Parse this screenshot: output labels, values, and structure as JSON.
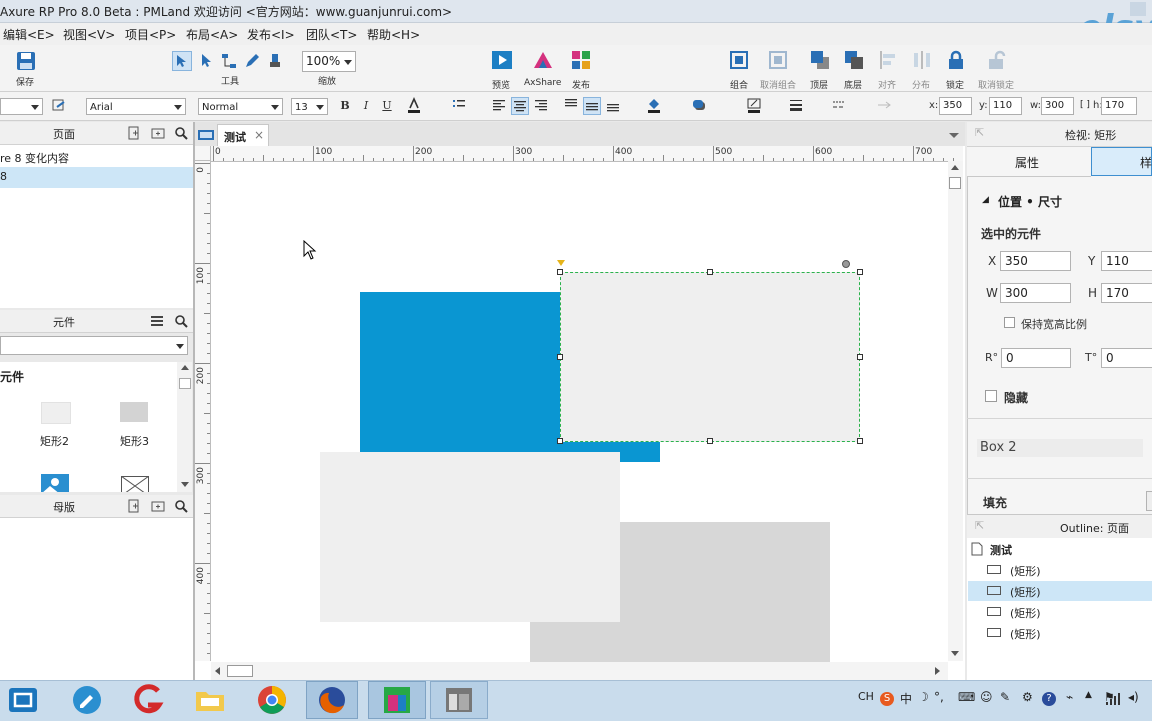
{
  "window": {
    "title": "Axure RP Pro 8.0 Beta : PMLand 欢迎访问 <官方网站：www.guanjunrui.com>",
    "watermark": "elsy"
  },
  "menu": [
    "编辑<E>",
    "视图<V>",
    "项目<P>",
    "布局<A>",
    "发布<I>",
    "团队<T>",
    "帮助<H>"
  ],
  "toolbar": {
    "save": "保存",
    "tools": "工具",
    "zoom_value": "100%",
    "zoom_label": "缩放",
    "preview": "预览",
    "axshare": "AxShare",
    "publish": "发布",
    "group": "组合",
    "ungroup": "取消组合",
    "front": "顶层",
    "back": "底层",
    "align": "对齐",
    "distribute": "分布",
    "lock": "锁定",
    "unlock": "取消锁定"
  },
  "format": {
    "font": "Arial",
    "style": "Normal",
    "size": "13",
    "bold": "B",
    "italic": "I",
    "underline": "U",
    "x_label": "x:",
    "x": "350",
    "y_label": "y:",
    "y": "110",
    "w_label": "w:",
    "w": "300",
    "h_label": "h:",
    "h": "170"
  },
  "pages_panel": {
    "title": "页面",
    "items": [
      "re 8 变化内容",
      "8"
    ]
  },
  "widgets_panel": {
    "title": "元件",
    "section": "元件",
    "items": [
      "矩形2",
      "矩形3"
    ]
  },
  "masters_panel": {
    "title": "母版"
  },
  "tab": {
    "label": "测试",
    "close": "×"
  },
  "ruler_h": [
    "0",
    "100",
    "200",
    "300",
    "400",
    "500",
    "600",
    "700"
  ],
  "ruler_v": [
    "0",
    "100",
    "200",
    "300",
    "400",
    "300"
  ],
  "inspector": {
    "title": "检视: 矩形",
    "tab_props": "属性",
    "tab_style": "样",
    "section": "位置 • 尺寸",
    "selected": "选中的元件",
    "x_label": "X",
    "x": "350",
    "y_label": "Y",
    "y": "110",
    "w_label": "W",
    "w": "300",
    "h_label": "H",
    "h": "170",
    "ratio": "保持宽高比例",
    "r_label": "R°",
    "r": "0",
    "t_label": "T°",
    "t": "0",
    "hidden": "隐藏",
    "name": "Box 2",
    "fill": "填充"
  },
  "outline": {
    "title": "Outline: 页面",
    "root": "测试",
    "items": [
      "(矩形)",
      "(矩形)",
      "(矩形)",
      "(矩形)"
    ]
  },
  "tray": {
    "ime": "CH",
    "s": "S",
    "zh": "中"
  },
  "colors": {
    "blue_rect": "#0a96d2",
    "light_rect": "#efefef",
    "gray_rect": "#d7d7d7",
    "selection": "#2bb24c",
    "selected_row": "#cde6f7"
  }
}
